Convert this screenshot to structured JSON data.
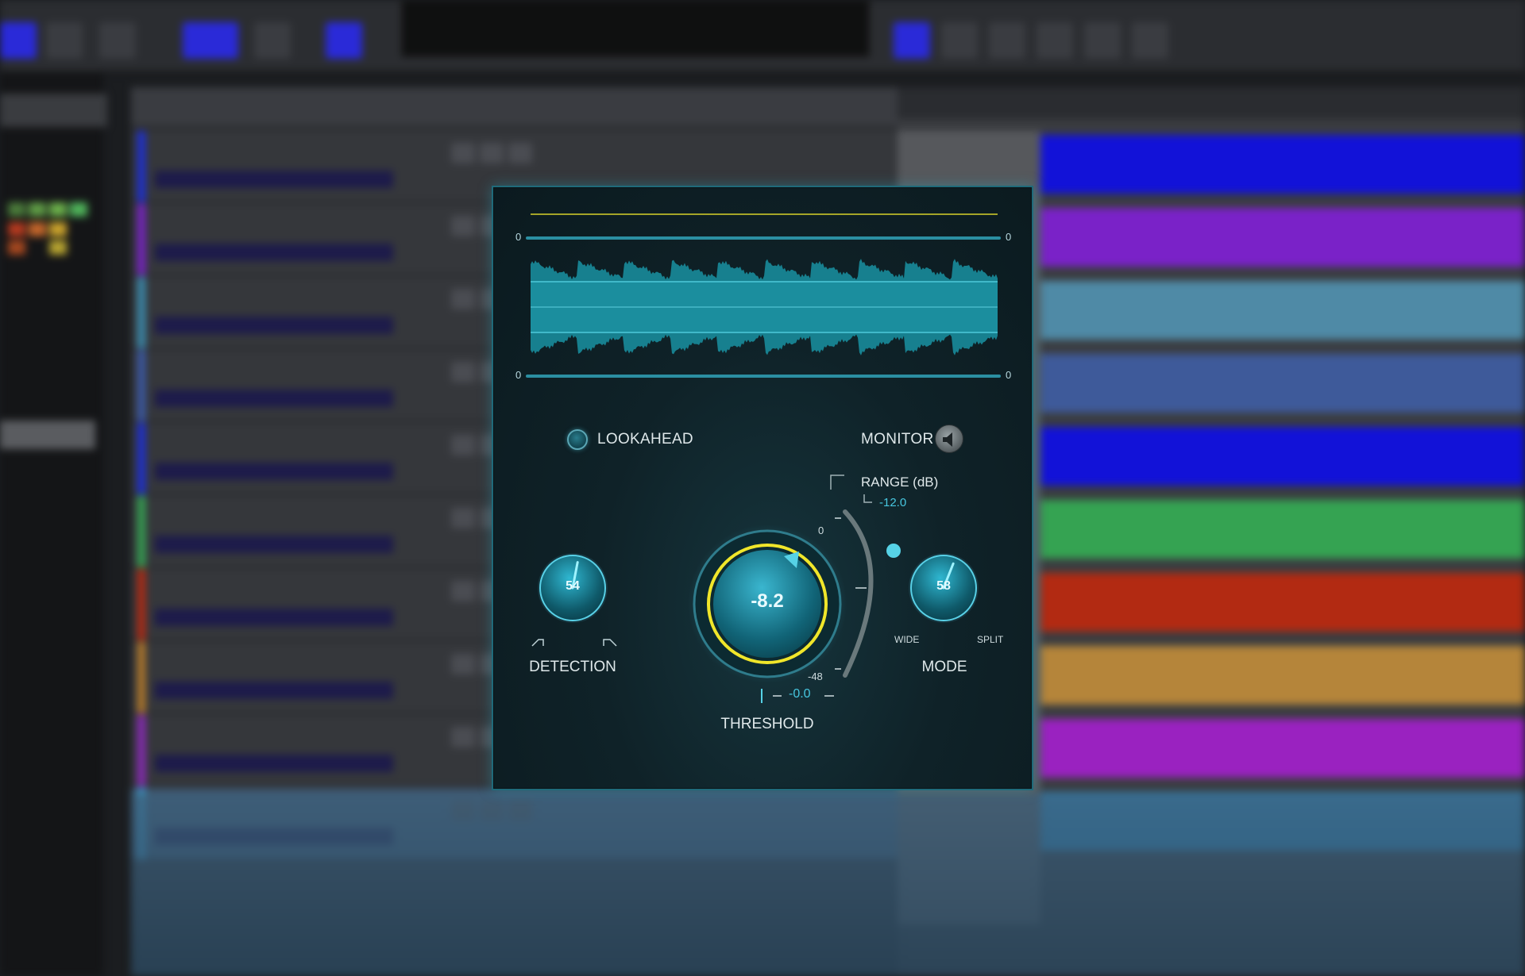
{
  "plugin": {
    "scope": {
      "top_left": "0",
      "top_right": "0",
      "bottom_left": "0",
      "bottom_right": "0"
    },
    "lookahead": {
      "label": "LOOKAHEAD",
      "enabled": true
    },
    "monitor": {
      "label": "MONITOR",
      "icon": "speaker-icon"
    },
    "detection": {
      "label": "DETECTION",
      "value": "54",
      "level": 0.54
    },
    "threshold": {
      "label": "THRESHOLD",
      "value": "-8.2",
      "scale_top": "0",
      "scale_bottom": "-48",
      "readout": "-0.0"
    },
    "range": {
      "label": "RANGE (dB)",
      "value": "-12.0"
    },
    "mode": {
      "label": "MODE",
      "value": "58",
      "level": 0.58,
      "left_label": "WIDE",
      "right_label": "SPLIT"
    },
    "colors": {
      "accent": "#47c7e0",
      "threshold_ring": "#f0e62a",
      "panel": "#0f2228"
    }
  }
}
